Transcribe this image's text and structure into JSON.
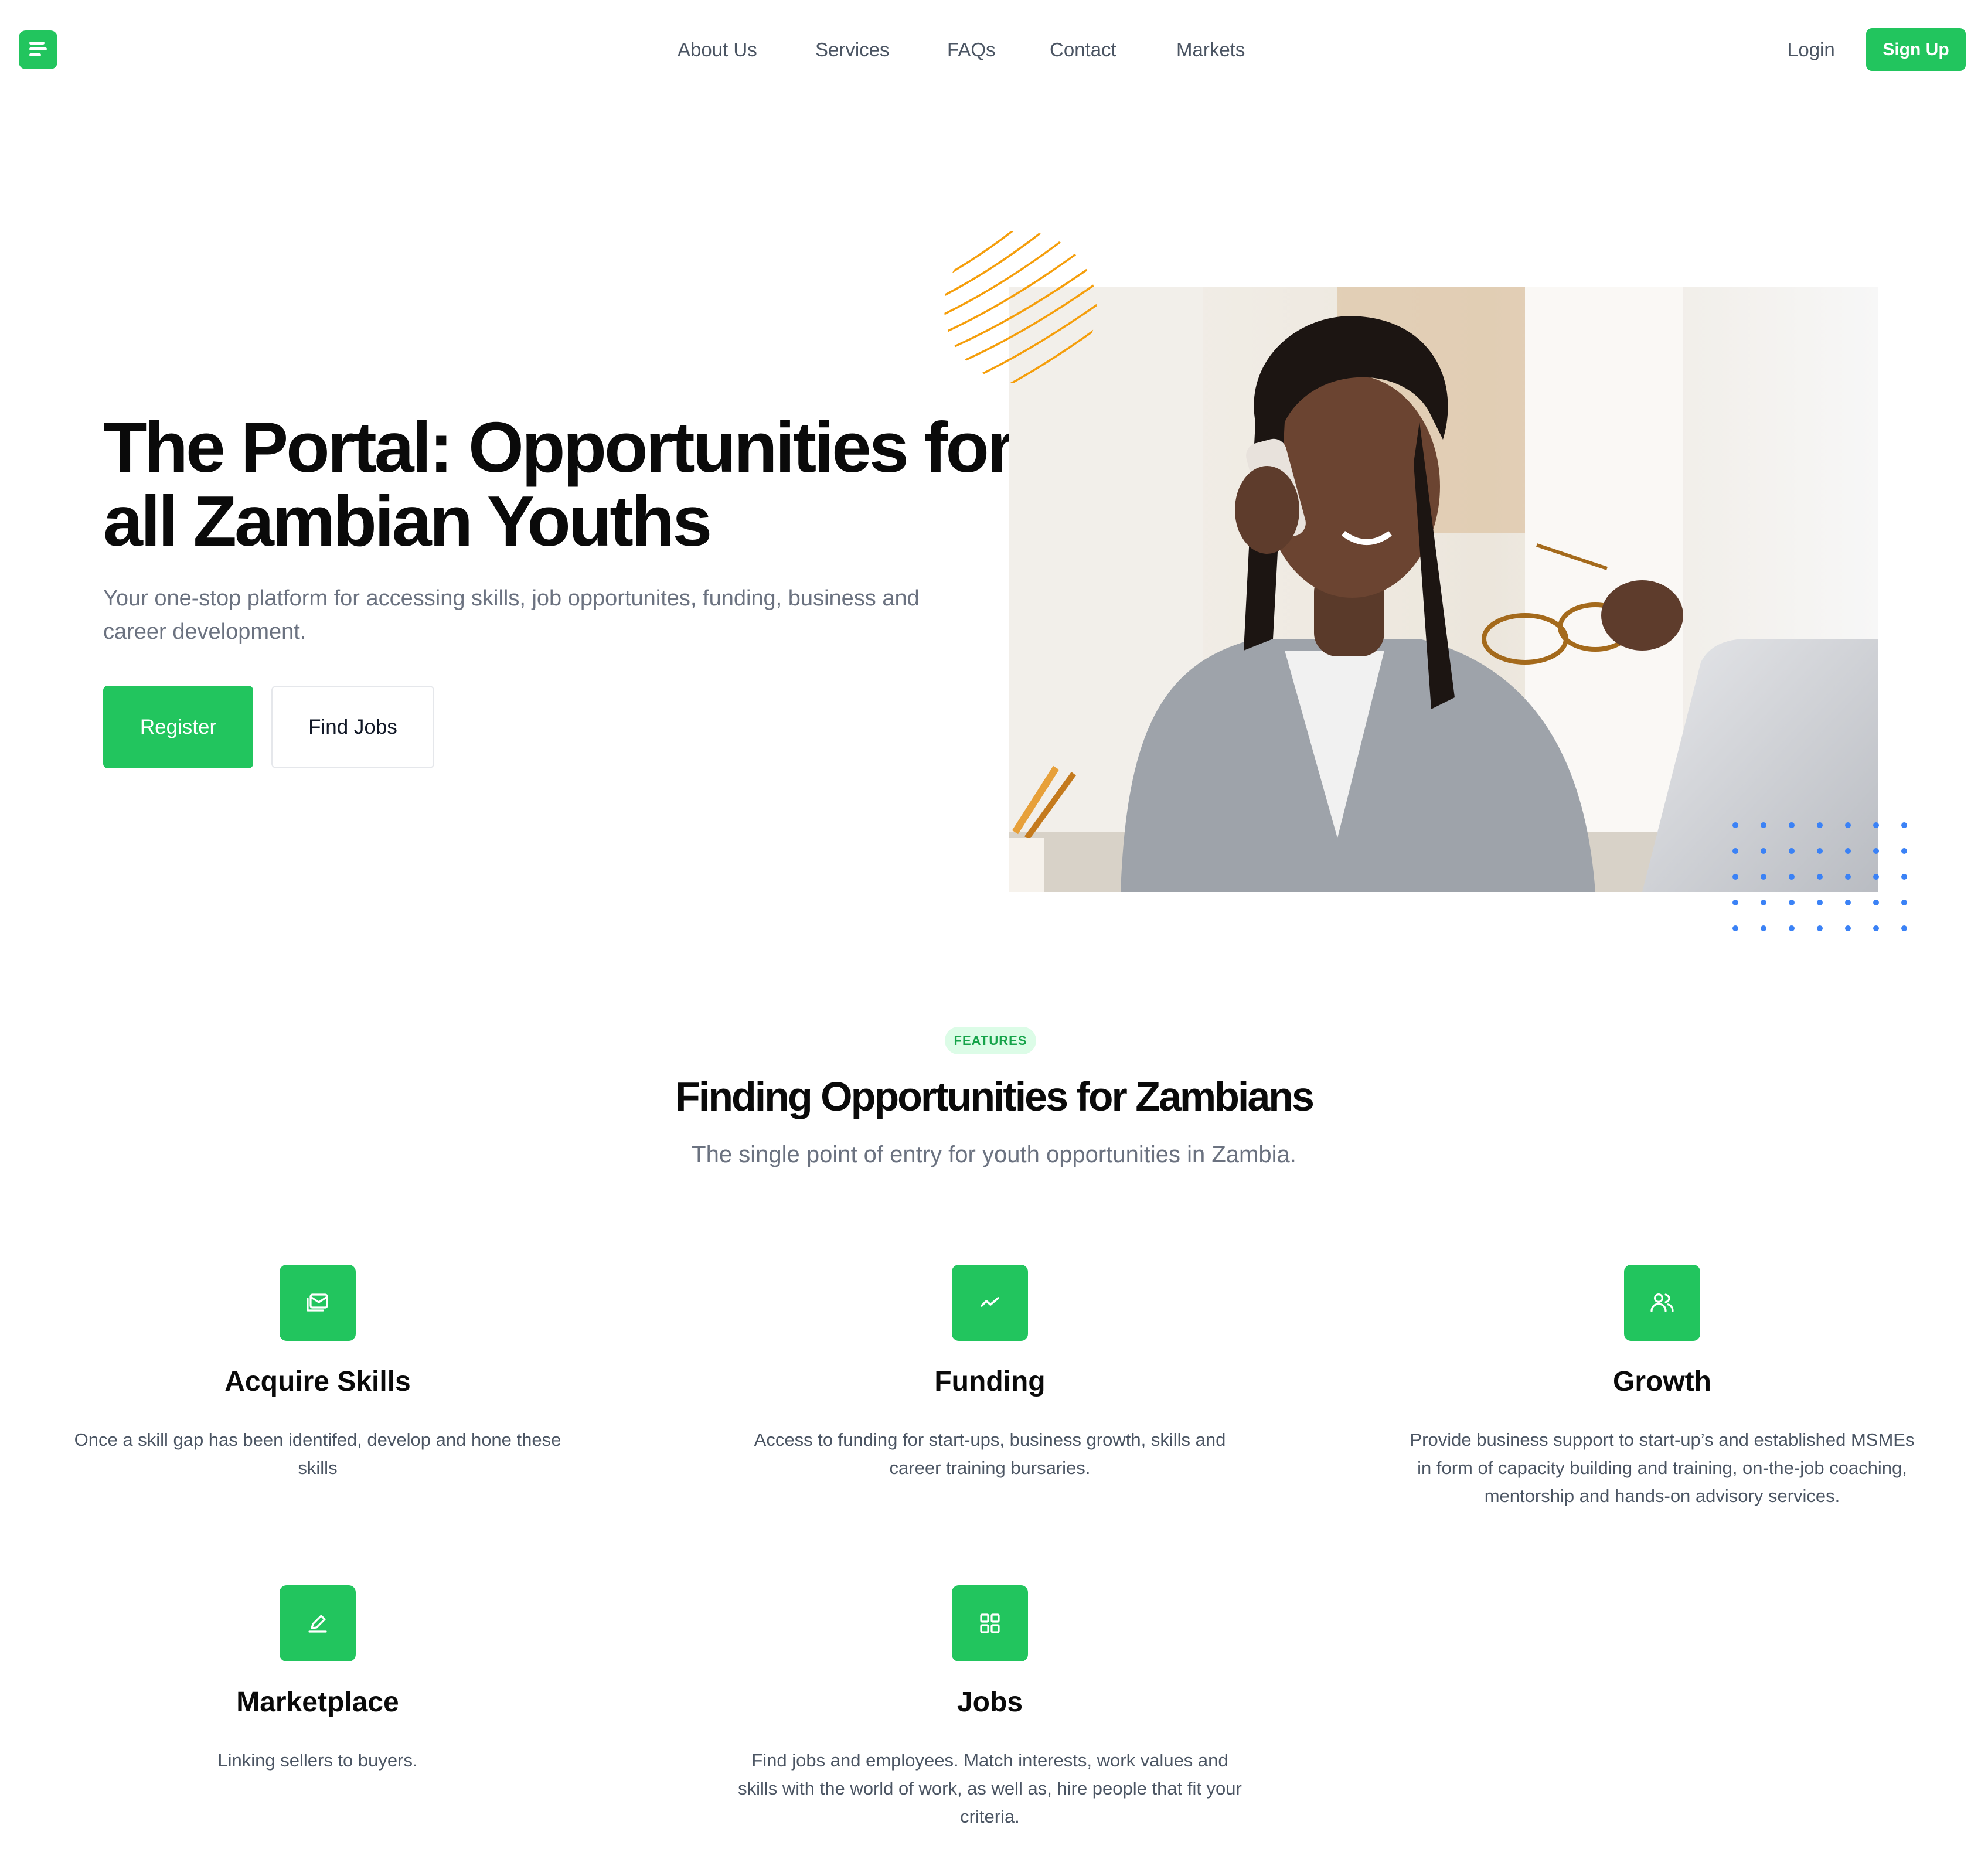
{
  "nav": {
    "links": [
      "About Us",
      "Services",
      "FAQs",
      "Contact",
      "Markets"
    ],
    "login": "Login",
    "signup": "Sign Up"
  },
  "hero": {
    "title": "The Portal: Opportunities for all Zambian Youths",
    "subtitle": "Your one-stop platform for accessing skills, job opportunites, funding, business and career development.",
    "register": "Register",
    "find_jobs": "Find Jobs"
  },
  "features": {
    "badge": "FEATURES",
    "title": "Finding Opportunities for Zambians",
    "subtitle": "The single point of entry for youth opportunities in Zambia.",
    "items": [
      {
        "icon": "skills-icon",
        "title": "Acquire Skills",
        "desc": "Once a skill gap has been identifed, develop and hone these skills"
      },
      {
        "icon": "trend-icon",
        "title": "Funding",
        "desc": "Access to funding for start-ups, business growth, skills and career training bursaries."
      },
      {
        "icon": "users-icon",
        "title": "Growth",
        "desc": "Provide business support to start-up’s and established MSMEs in form of capacity building and training, on-the-job coaching, mentorship and hands-on advisory services."
      },
      {
        "icon": "pencil-icon",
        "title": "Marketplace",
        "desc": "Linking sellers to buyers."
      },
      {
        "icon": "grid-icon",
        "title": "Jobs",
        "desc": "Find jobs and employees. Match interests, work values and skills with the world of work, as well as, hire people that fit your criteria."
      }
    ]
  },
  "colors": {
    "brand": "#22c55e",
    "badge_bg": "#dcfce7",
    "accent_orange": "#f59e0b",
    "accent_blue": "#3b82f6"
  }
}
